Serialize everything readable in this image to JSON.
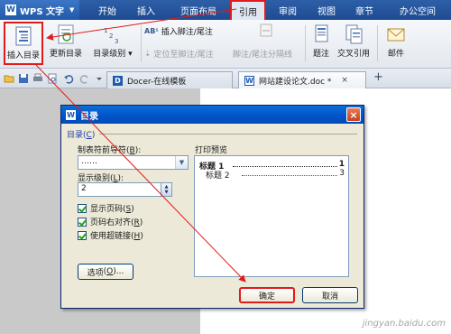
{
  "menubar": {
    "app_name": "WPS 文字",
    "tabs": [
      "开始",
      "插入",
      "页面布局",
      "引用",
      "审阅",
      "视图",
      "章节",
      "办公空间"
    ],
    "active_tab": "引用"
  },
  "ribbon": {
    "insert_toc": "插入目录",
    "update_toc": "更新目录",
    "toc_level": "目录级别",
    "insert_footnote": "插入脚注/尾注",
    "locate_footnote": "定位至脚注/尾注",
    "footnote_separator": "脚注/尾注分隔线",
    "caption": "题注",
    "cross_ref": "交叉引用",
    "mail": "邮件"
  },
  "tabbar": {
    "tabs": [
      {
        "label": "Docer-在线模板",
        "active": false
      },
      {
        "label": "网站建设论文.doc *",
        "active": true
      }
    ],
    "add_label": "+"
  },
  "dialog": {
    "title": "目录",
    "close_label": "×",
    "section_label": "目录",
    "section_hotkey": "C",
    "leader_label": "制表符前导符",
    "leader_hotkey": "B",
    "leader_value": "……",
    "level_label": "显示级别",
    "level_hotkey": "L",
    "level_value": "2",
    "checkboxes": [
      {
        "label": "显示页码",
        "hotkey": "S",
        "checked": true
      },
      {
        "label": "页码右对齐",
        "hotkey": "R",
        "checked": true
      },
      {
        "label": "使用超链接",
        "hotkey": "H",
        "checked": true
      }
    ],
    "options_label": "选项",
    "options_hotkey": "O",
    "preview_label": "打印预览",
    "preview": {
      "heading1": "标题 1",
      "heading1_page": "1",
      "heading2": "标题 2",
      "heading2_page": "3"
    },
    "ok_label": "确定",
    "cancel_label": "取消"
  },
  "watermark": "jingyan.baidu.com",
  "colors": {
    "annotation": "#e01b1b",
    "menubar": "#1e4b91"
  }
}
